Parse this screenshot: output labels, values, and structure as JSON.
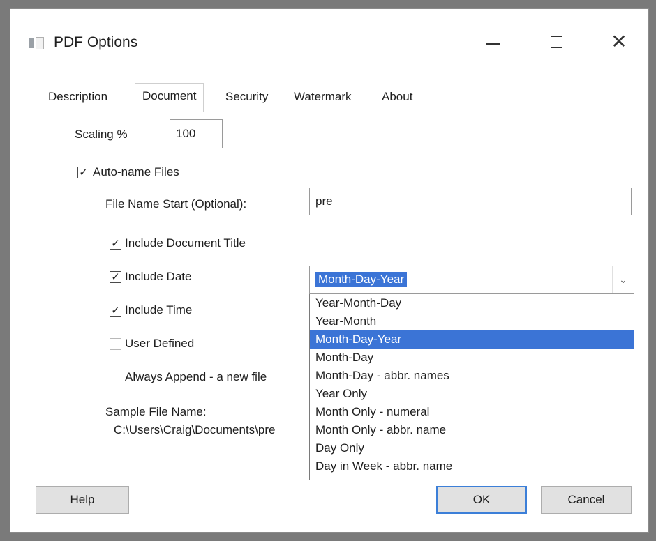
{
  "window": {
    "title": "PDF Options",
    "controls": {
      "minimize": "—",
      "maximize": "",
      "close": "✕"
    }
  },
  "tabs": [
    {
      "label": "Description",
      "active": false
    },
    {
      "label": "Document",
      "active": true
    },
    {
      "label": "Security",
      "active": false
    },
    {
      "label": "Watermark",
      "active": false
    },
    {
      "label": "About",
      "active": false
    }
  ],
  "document": {
    "scaling_label": "Scaling %",
    "scaling_value": "100",
    "auto_name": {
      "label": "Auto-name Files",
      "checked": true
    },
    "file_name_start_label": "File Name Start (Optional):",
    "file_name_start_value": "pre",
    "include_title": {
      "label": "Include Document Title",
      "checked": true
    },
    "include_date": {
      "label": "Include Date",
      "checked": true
    },
    "include_time": {
      "label": "Include Time",
      "checked": true
    },
    "user_defined": {
      "label": "User Defined",
      "checked": false
    },
    "always_append": {
      "label": "Always Append - a new file",
      "checked": false
    },
    "sample_label": "Sample File Name:",
    "sample_value": "C:\\Users\\Craig\\Documents\\pre"
  },
  "date_format": {
    "selected": "Month-Day-Year",
    "options": [
      "Year-Month-Day",
      "Year-Month",
      "Month-Day-Year",
      "Month-Day",
      "Month-Day - abbr. names",
      "Year Only",
      "Month Only - numeral",
      "Month Only - abbr. name",
      "Day Only",
      "Day in Week - abbr. name"
    ],
    "selected_index": 2
  },
  "buttons": {
    "help": "Help",
    "ok": "OK",
    "cancel": "Cancel"
  },
  "colors": {
    "selection": "#3b74d6",
    "default_button_border": "#3c7fd8"
  }
}
